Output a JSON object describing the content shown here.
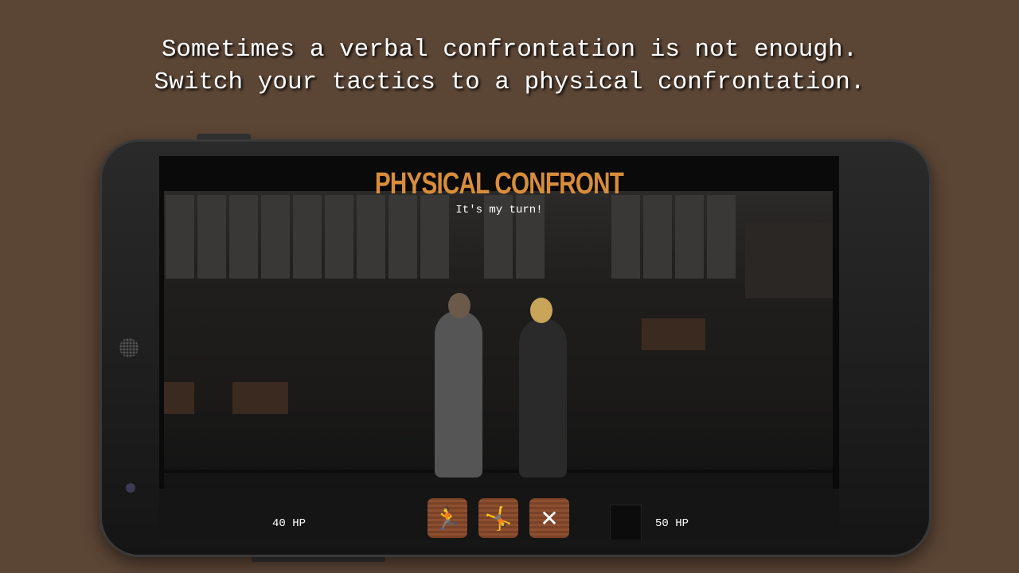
{
  "caption": {
    "line1": "Sometimes a verbal confrontation is not enough.",
    "line2": "Switch your tactics to a physical confrontation."
  },
  "game": {
    "title": "PHYSICAL CONFRONT",
    "status": "It's my turn!",
    "player_hp": "40 HP",
    "opponent_hp": "50 HP",
    "title_color": "#d98d3a",
    "actions": [
      {
        "name": "dodge",
        "icon": "running-figure-icon",
        "glyph": "🏃"
      },
      {
        "name": "kick",
        "icon": "kicking-figure-icon",
        "glyph": "🤸"
      },
      {
        "name": "cancel",
        "icon": "close-icon",
        "glyph": "✕"
      }
    ]
  }
}
